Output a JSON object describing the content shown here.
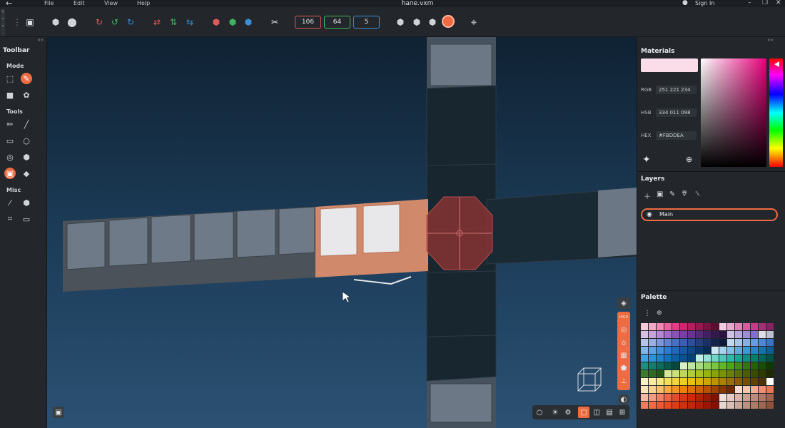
{
  "menu": {
    "items": [
      "File",
      "Edit",
      "View",
      "Help"
    ],
    "title": "hane.vxm",
    "sign_in": "Sign In"
  },
  "toolbar": {
    "values": [
      "106",
      "64",
      "5"
    ],
    "value_colors": [
      "#e05a5a",
      "#3fb35f",
      "#3a8fd6"
    ]
  },
  "left_toolbar": {
    "title": "Toolbar",
    "sections": [
      "Mode",
      "Tools",
      "Misc"
    ]
  },
  "materials": {
    "heading": "Materials",
    "rgb_label": "RGB",
    "rgb_value": "251  221  234",
    "hsb_label": "HSB",
    "hsb_value": "334  011  098",
    "hex_label": "HEX",
    "hex_value": "#FBDDEA",
    "current_color": "#FBDDEA"
  },
  "layers": {
    "heading": "Layers",
    "items": [
      {
        "label": "Main",
        "visible": true
      }
    ]
  },
  "palette": {
    "heading": "Palette",
    "rows": [
      [
        "#f6c9db",
        "#f3a9c6",
        "#ef87b2",
        "#ea609b",
        "#e43c86",
        "#d4246f",
        "#b91c5f",
        "#9a164f",
        "#7b1140",
        "#5e0c31",
        "#f2cbe0",
        "#e9a9cc",
        "#dd84b6",
        "#cf5f9f",
        "#c13f8a",
        "#a52e75",
        "#832361"
      ],
      [
        "#d7bfe6",
        "#c7a3dc",
        "#b586d2",
        "#a26bc7",
        "#8e52bb",
        "#7a3eaa",
        "#683393",
        "#55297b",
        "#432063",
        "#33184c",
        "#2a1340",
        "#d0c4e6",
        "#b6a8dc",
        "#9c8cd2",
        "#8271c7",
        "#dedfe6",
        "#bcbfd0"
      ],
      [
        "#b7c4ea",
        "#9aaee2",
        "#7d98da",
        "#6283d1",
        "#4a6fc7",
        "#3a5db5",
        "#2e4d9b",
        "#243e80",
        "#1b3066",
        "#13234d",
        "#0d1a3a",
        "#c6d8f0",
        "#a7c4ea",
        "#88b0e3",
        "#699cdc",
        "#4e88d4",
        "#3a74c4"
      ],
      [
        "#7fb6ea",
        "#5ea2e4",
        "#3f8edd",
        "#2a7ad1",
        "#1f68bd",
        "#1657a3",
        "#0f4788",
        "#09386e",
        "#052a55",
        "#cfe6f3",
        "#a9d3ea",
        "#83c0e1",
        "#5eadd8",
        "#3b9acf",
        "#2486c1",
        "#1672aa",
        "#0b5f92"
      ],
      [
        "#3fa3e0",
        "#2d93d6",
        "#1c82c9",
        "#1272b8",
        "#0a62a4",
        "#06528d",
        "#044377",
        "#bfeee8",
        "#98e2d9",
        "#70d6c9",
        "#48c9b9",
        "#27bba8",
        "#13a894",
        "#0b927f",
        "#067c6b",
        "#036657",
        "#015144"
      ],
      [
        "#1e8f7c",
        "#147d6b",
        "#0c6b5b",
        "#075a4b",
        "#03493c",
        "#d7f0c4",
        "#c0e7a2",
        "#a8dd80",
        "#90d25f",
        "#79c641",
        "#63b72b",
        "#4fa51c",
        "#3e8f12",
        "#30780b",
        "#236206",
        "#184d03",
        "#0f3901"
      ],
      [
        "#3a7d2c",
        "#2e6b22",
        "#235a19",
        "#d7e89a",
        "#cbe078",
        "#bfd757",
        "#b2cd39",
        "#a5c21f",
        "#97b50f",
        "#89a505",
        "#7a9401",
        "#6a8200",
        "#5a7000",
        "#4a5e00",
        "#3b4c00",
        "#2d3b00",
        "#202a00"
      ],
      [
        "#fbf3c6",
        "#faeda2",
        "#f8e67e",
        "#f6df5b",
        "#f3d73a",
        "#f0ce1d",
        "#e9c209",
        "#ddb300",
        "#cfa300",
        "#bf9200",
        "#ad8100",
        "#9a7000",
        "#876000",
        "#735000",
        "#5f4100",
        "#4c3300",
        "#ffffff"
      ],
      [
        "#fde4b8",
        "#fcd08f",
        "#fbbc67",
        "#f9a841",
        "#f7941f",
        "#f08108",
        "#e06f00",
        "#cd5f00",
        "#b75000",
        "#a04200",
        "#873500",
        "#6f2900",
        "#faddd2",
        "#f7c4b2",
        "#f3aa92",
        "#ef9073",
        "#eb7656"
      ],
      [
        "#f7b8a4",
        "#f49c83",
        "#f08063",
        "#eb6444",
        "#e64a28",
        "#dc3712",
        "#c82b06",
        "#b12200",
        "#981a00",
        "#7f1300",
        "#f0e0dc",
        "#e4cbc4",
        "#d7b5ac",
        "#caa094",
        "#bd8b7d",
        "#b07767",
        "#a36351"
      ],
      [
        "#f27b5c",
        "#ef6a48",
        "#ec5934",
        "#e84921",
        "#e03c13",
        "#d2300a",
        "#c22604",
        "#b01d01",
        "#9d1500",
        "#8a0e00",
        "#e8d6cf",
        "#d9bfb4",
        "#caa99a",
        "#bb9281",
        "#ac7c69",
        "#9d6752",
        "#8e533d"
      ]
    ]
  }
}
